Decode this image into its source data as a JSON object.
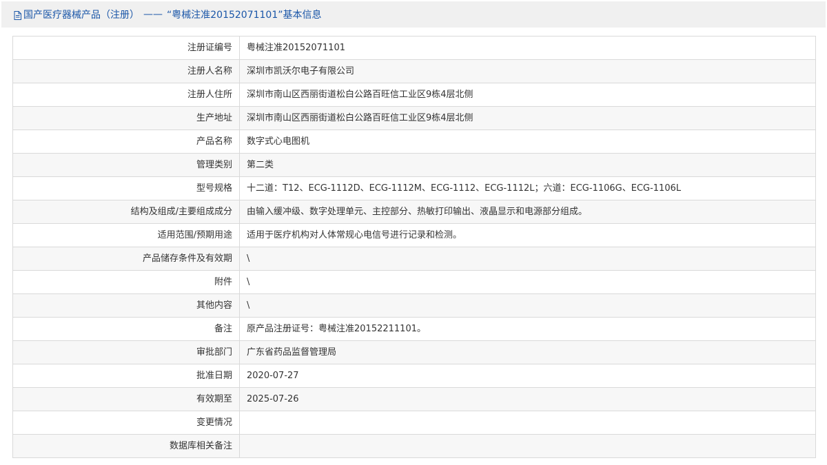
{
  "header": {
    "title_prefix": "国产医疗器械产品（注册）",
    "dash": "——",
    "title_suffix": "“粤械注准20152071101”基本信息"
  },
  "rows": [
    {
      "label": "注册证编号",
      "value": "粤械注准20152071101"
    },
    {
      "label": "注册人名称",
      "value": "深圳市凯沃尔电子有限公司"
    },
    {
      "label": "注册人住所",
      "value": "深圳市南山区西丽街道松白公路百旺信工业区9栋4层北侧"
    },
    {
      "label": "生产地址",
      "value": "深圳市南山区西丽街道松白公路百旺信工业区9栋4层北侧"
    },
    {
      "label": "产品名称",
      "value": "数字式心电图机"
    },
    {
      "label": "管理类别",
      "value": "第二类"
    },
    {
      "label": "型号规格",
      "value": "十二道：T12、ECG-1112D、ECG-1112M、ECG-1112、ECG-1112L；六道：ECG-1106G、ECG-1106L"
    },
    {
      "label": "结构及组成/主要组成成分",
      "value": "由输入缓冲级、数字处理单元、主控部分、热敏打印输出、液晶显示和电源部分组成。"
    },
    {
      "label": "适用范围/预期用途",
      "value": "适用于医疗机构对人体常规心电信号进行记录和检测。"
    },
    {
      "label": "产品储存条件及有效期",
      "value": "\\"
    },
    {
      "label": "附件",
      "value": "\\"
    },
    {
      "label": "其他内容",
      "value": "\\"
    },
    {
      "label": "备注",
      "value": "原产品注册证号：粤械注准20152211101。"
    },
    {
      "label": "审批部门",
      "value": "广东省药品监督管理局"
    },
    {
      "label": "批准日期",
      "value": "2020-07-27"
    },
    {
      "label": "有效期至",
      "value": "2025-07-26"
    },
    {
      "label": "变更情况",
      "value": ""
    },
    {
      "label": "数据库相关备注",
      "value": ""
    }
  ]
}
